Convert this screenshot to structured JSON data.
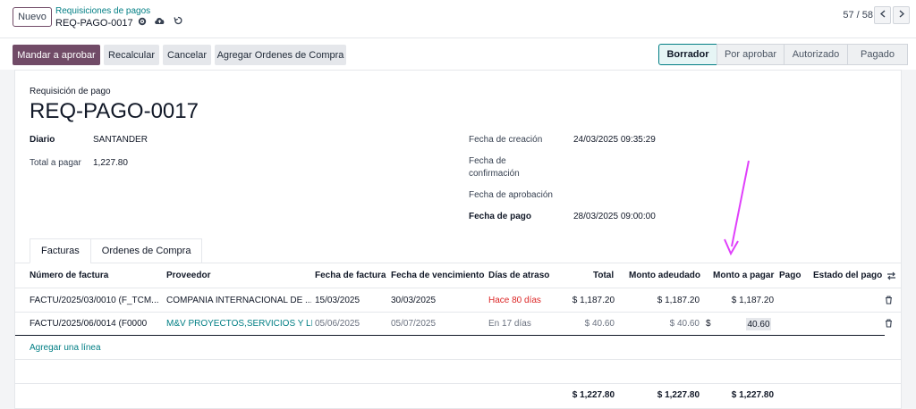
{
  "header": {
    "new_button": "Nuevo",
    "breadcrumb_parent": "Requisiciones de pagos",
    "breadcrumb_current": "REQ-PAGO-0017",
    "pager": "57 / 58"
  },
  "actions": {
    "send_approval": "Mandar a aprobar",
    "recalc": "Recalcular",
    "cancel": "Cancelar",
    "add_orders": "Agregar Ordenes de Compra"
  },
  "statusbar": [
    "Borrador",
    "Por aprobar",
    "Autorizado",
    "Pagado"
  ],
  "form": {
    "subtitle": "Requisición de pago",
    "title": "REQ-PAGO-0017",
    "journal_label": "Diario",
    "journal_value": "SANTANDER",
    "total_label": "Total a pagar",
    "total_value": "1,227.80",
    "created_label": "Fecha de creación",
    "created_value": "24/03/2025 09:35:29",
    "confirm_label_1": "Fecha de",
    "confirm_label_2": "confirmación",
    "approval_label": "Fecha de aprobación",
    "payment_label": "Fecha de pago",
    "payment_value": "28/03/2025 09:00:00"
  },
  "tabs": [
    "Facturas",
    "Ordenes de Compra"
  ],
  "table": {
    "headers": [
      "Número de factura",
      "Proveedor",
      "Fecha de factura",
      "Fecha de vencimiento",
      "Días de atraso",
      "Total",
      "Monto adeudado",
      "Monto a pagar",
      "Pago",
      "Estado del pago"
    ],
    "rows": [
      {
        "invoice": "FACTU/2025/03/0010 (F_TCM...",
        "vendor": "COMPAÑIA INTERNACIONAL DE ...",
        "inv_date": "15/03/2025",
        "due_date": "30/03/2025",
        "delay": "Hace 80 días",
        "total": "$ 1,187.20",
        "due_amount": "$ 1,187.20",
        "to_pay": "$ 1,187.20"
      },
      {
        "invoice": "FACTU/2025/06/0014 (F0000",
        "vendor": "M&V PROYECTOS,SERVICIOS Y LIM",
        "inv_date": "05/06/2025",
        "due_date": "05/07/2025",
        "delay": "En 17 días",
        "total": "$ 40.60",
        "due_amount": "$ 40.60",
        "to_pay_currency": "$",
        "to_pay_value": "40.60"
      }
    ],
    "add_line": "Agregar una línea",
    "footer": {
      "total": "$ 1,227.80",
      "due_amount": "$ 1,227.80",
      "to_pay": "$ 1,227.80"
    }
  },
  "colors": {
    "primary": "#714b67",
    "accent": "#017e84",
    "danger": "#dc2626",
    "annotation_arrow": "#e040fb"
  }
}
